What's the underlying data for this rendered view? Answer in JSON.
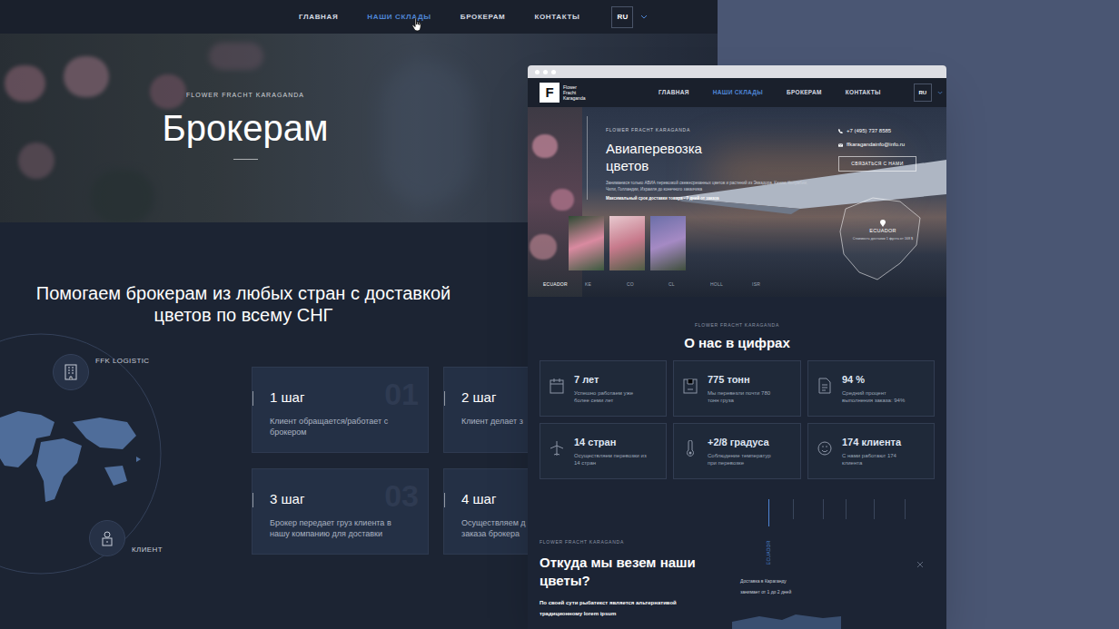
{
  "left_page": {
    "nav": {
      "items": [
        {
          "label": "ГЛАВНАЯ",
          "selected": false
        },
        {
          "label": "НАШИ СКЛАДЫ",
          "selected": true
        },
        {
          "label": "БРОКЕРАМ",
          "selected": false
        },
        {
          "label": "КОНТАКТЫ",
          "selected": false
        }
      ],
      "language": "RU"
    },
    "hero": {
      "eyebrow": "FLOWER FRACHT KARAGANDA",
      "title": "Брокерам"
    },
    "heading": "Помогаем брокерам из любых стран с доставкой цветов по всему СНГ",
    "diagram": {
      "nodes": [
        {
          "label": "FFK LOGISTIC"
        },
        {
          "label": "КЛИЕНТ"
        }
      ]
    },
    "steps": [
      {
        "number": "01",
        "title": "1 шаг",
        "lines": [
          "Клиент обращается/работает с",
          "брокером"
        ]
      },
      {
        "title": "2 шаг",
        "lines": [
          "Клиент делает з"
        ]
      },
      {
        "number": "03",
        "title": "3 шаг",
        "lines": [
          "Брокер передает груз клиента в",
          "нашу компанию для доставки"
        ]
      },
      {
        "title": "4 шаг",
        "lines": [
          "Осуществляем д",
          "заказа брокера"
        ]
      }
    ]
  },
  "mockup": {
    "nav": {
      "logo_letter": "F",
      "logo_text": [
        "Flower",
        "Fracht",
        "Karaganda"
      ],
      "items": [
        {
          "label": "ГЛАВНАЯ",
          "selected": false
        },
        {
          "label": "НАШИ СКЛАДЫ",
          "selected": true
        },
        {
          "label": "БРОКЕРАМ",
          "selected": false
        },
        {
          "label": "КОНТАКТЫ",
          "selected": false
        }
      ],
      "language": "RU"
    },
    "hero": {
      "eyebrow": "FLOWER FRACHT KARAGANDA",
      "title_lines": [
        "Авиаперевозка",
        "цветов"
      ],
      "description": "Занимаемся только АВИА перевозкой свежесрезанных цветов и растений из Эквадора, Кении, Колумбии, Чили, Голландии, Израиля до конечного заказчика",
      "note": "Максимальный срок доставки товара - 7 дней от заказа",
      "phone": "+7 (495) 737 8585",
      "email": "ffkaragandainfo@info.ru",
      "button": "СВЯЗАТЬСЯ С НАМИ",
      "map": {
        "country": "ECUADOR",
        "caption": "Стоимость доставки 1 фунта от 168 $"
      },
      "countries": [
        {
          "label": "ECUADOR",
          "selected": true
        },
        {
          "label": "KE",
          "selected": false
        },
        {
          "label": "CO",
          "selected": false
        },
        {
          "label": "CL",
          "selected": false
        },
        {
          "label": "HOLL",
          "selected": false
        },
        {
          "label": "ISR",
          "selected": false
        }
      ]
    },
    "stats": {
      "eyebrow": "FLOWER FRACHT KARAGANDA",
      "title": "О нас в цифрах",
      "items": [
        {
          "value": "7 лет",
          "text": "Успешно работаем уже более семи лет"
        },
        {
          "value": "775 тонн",
          "text": "Мы перевезли почти 780 тонн груза"
        },
        {
          "value": "94 %",
          "text": "Средний процент выполнения заказа: 94%"
        },
        {
          "value": "14 стран",
          "text": "Осуществляем перевозки из 14 стран"
        },
        {
          "value": "+2/8 градуса",
          "text": "Соблюдение температур при перевозке"
        },
        {
          "value": "174 клиента",
          "text": "С нами работают 174 клиента"
        }
      ]
    },
    "origin": {
      "eyebrow": "FLOWER FRACHT KARAGANDA",
      "title_lines": [
        "Откуда мы везем наши",
        "цветы?"
      ],
      "lead": "По своей сути рыбатекст является альтернативой традиционному lorem ipsum",
      "timeline_label": "ECUADOR",
      "delivery": [
        "Доставка в Караганду",
        "занимает от 1 до 2 дней"
      ]
    }
  }
}
